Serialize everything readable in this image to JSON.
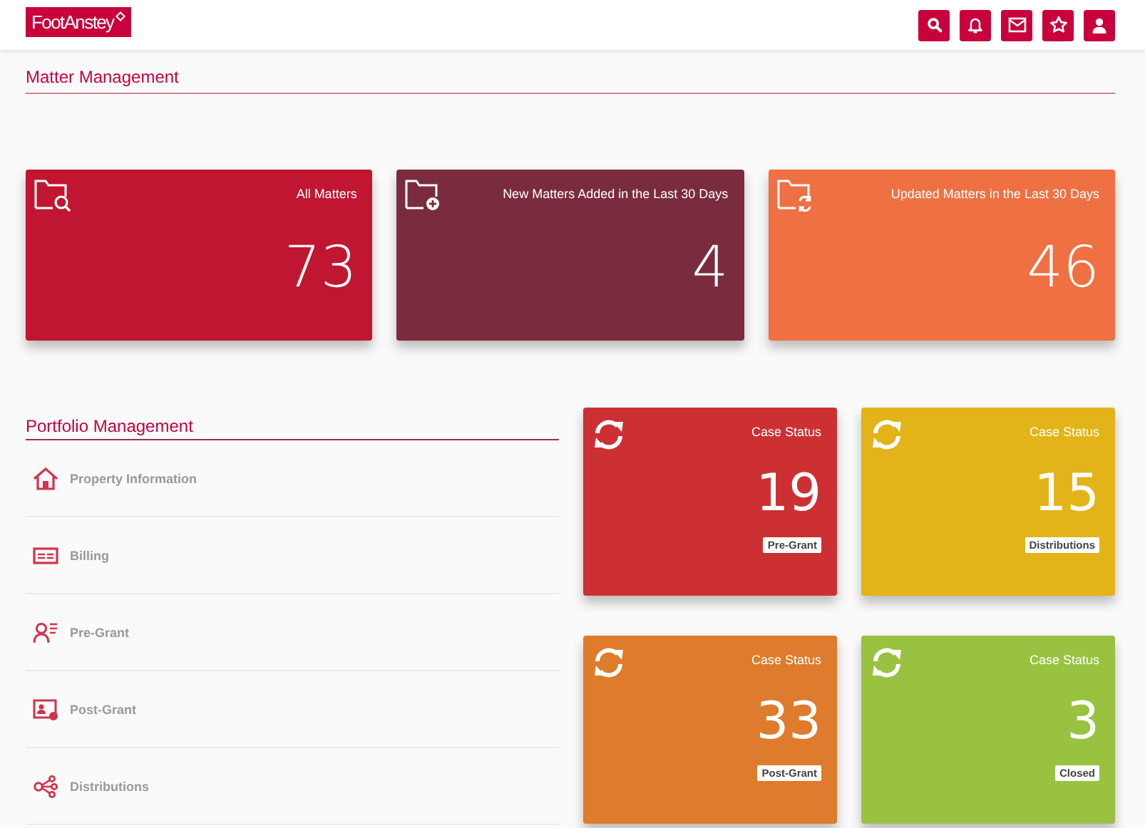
{
  "header": {
    "logo": "FootAnstey"
  },
  "matter_management": {
    "title": "Matter Management",
    "cards": [
      {
        "label": "All Matters",
        "count": "73",
        "color": "#c01631"
      },
      {
        "label": "New Matters Added in the Last 30 Days",
        "count": "4",
        "color": "#7a2c3e"
      },
      {
        "label": "Updated Matters in the Last 30 Days",
        "count": "46",
        "color": "#ef7043"
      }
    ]
  },
  "portfolio_management": {
    "title": "Portfolio Management",
    "items": [
      {
        "label": "Property Information"
      },
      {
        "label": "Billing"
      },
      {
        "label": "Pre-Grant"
      },
      {
        "label": "Post-Grant"
      },
      {
        "label": "Distributions"
      }
    ]
  },
  "case_status_cards": [
    {
      "label": "Case Status",
      "count": "19",
      "tag": "Pre-Grant",
      "color": "#cc3033"
    },
    {
      "label": "Case Status",
      "count": "15",
      "tag": "Distributions",
      "color": "#e3b419"
    },
    {
      "label": "Case Status",
      "count": "33",
      "tag": "Post-Grant",
      "color": "#de7b2c"
    },
    {
      "label": "Case Status",
      "count": "3",
      "tag": "Closed",
      "color": "#99c241"
    }
  ]
}
